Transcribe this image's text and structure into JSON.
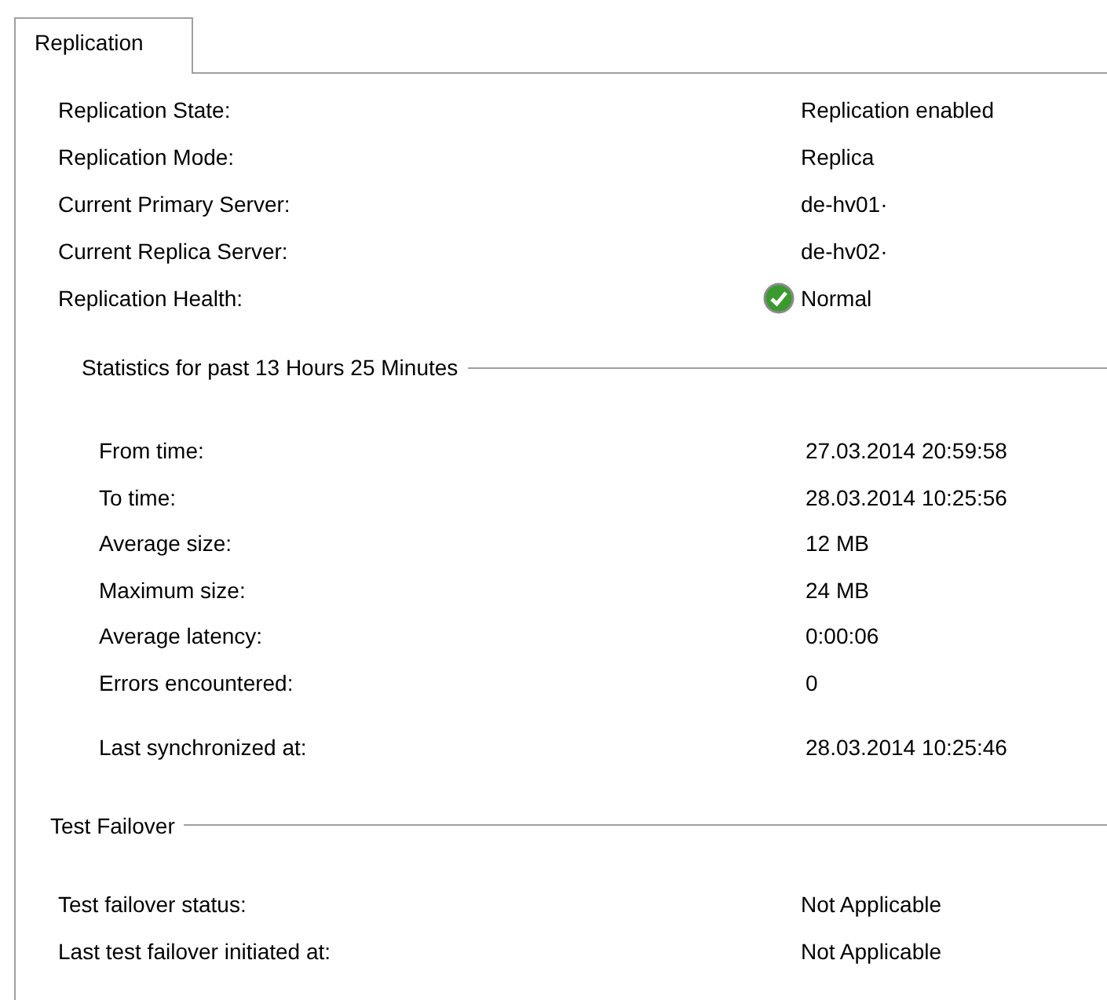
{
  "tabs": [
    {
      "label": "Replication",
      "selected": true
    }
  ],
  "summary": [
    {
      "label": "Replication State:",
      "value": "Replication enabled"
    },
    {
      "label": "Replication Mode:",
      "value": "Replica"
    },
    {
      "label": "Current Primary Server:",
      "value": "de-hv01·"
    },
    {
      "label": "Current Replica Server:",
      "value": "de-hv02·"
    },
    {
      "label": "Replication Health:",
      "value": "Normal",
      "healthy": true
    }
  ],
  "statistics": {
    "title": "Statistics for past 13 Hours 25 Minutes",
    "rows": [
      {
        "label": "From time:",
        "value": "27.03.2014 20:59:58"
      },
      {
        "label": "To time:",
        "value": "28.03.2014 10:25:56"
      },
      {
        "label": "Average size:",
        "value": "12 MB"
      },
      {
        "label": "Maximum size:",
        "value": "24 MB"
      },
      {
        "label": "Average latency:",
        "value": "0:00:06"
      },
      {
        "label": "Errors encountered:",
        "value": "0"
      }
    ],
    "last_sync": {
      "label": "Last synchronized at:",
      "value": "28.03.2014 10:25:46"
    }
  },
  "test_failover": {
    "title": "Test Failover",
    "rows": [
      {
        "label": "Test failover status:",
        "value": "Not Applicable"
      },
      {
        "label": "Last test failover initiated at:",
        "value": "Not Applicable"
      }
    ]
  }
}
